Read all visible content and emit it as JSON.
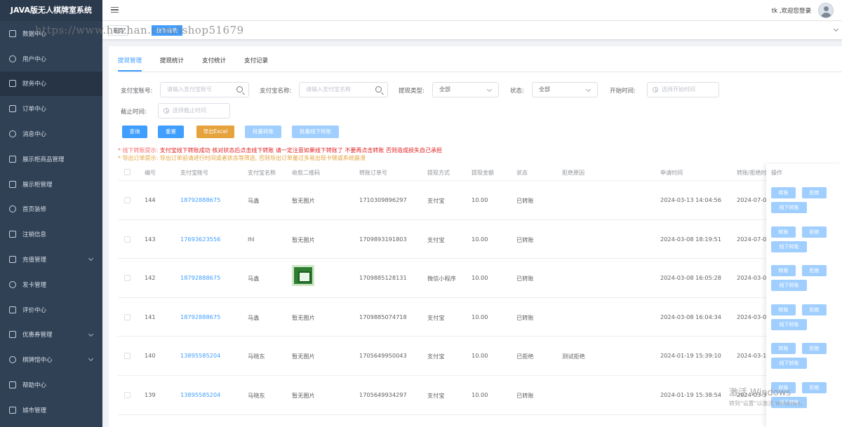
{
  "app": {
    "title": "JAVA版无人棋牌室系统"
  },
  "sidebar": {
    "items": [
      {
        "label": "数据中心",
        "icon": "dashboard-icon"
      },
      {
        "label": "用户中心",
        "icon": "user-icon"
      },
      {
        "label": "财务中心",
        "icon": "wallet-icon",
        "active": true
      },
      {
        "label": "订单中心",
        "icon": "order-icon"
      },
      {
        "label": "消息中心",
        "icon": "message-icon"
      },
      {
        "label": "展示柜商品管理",
        "icon": "box-icon"
      },
      {
        "label": "展示柜管理",
        "icon": "cabinet-icon"
      },
      {
        "label": "首页装修",
        "icon": "home-decor-icon"
      },
      {
        "label": "注销信息",
        "icon": "logout-icon"
      },
      {
        "label": "充值管理",
        "icon": "recharge-icon",
        "expandable": true
      },
      {
        "label": "发卡管理",
        "icon": "card-icon"
      },
      {
        "label": "评价中心",
        "icon": "comment-icon"
      },
      {
        "label": "优惠券管理",
        "icon": "coupon-icon",
        "expandable": true
      },
      {
        "label": "棋牌馆中心",
        "icon": "store-icon",
        "expandable": true
      },
      {
        "label": "帮助中心",
        "icon": "help-icon"
      },
      {
        "label": "城市管理",
        "icon": "city-icon"
      }
    ]
  },
  "topbar": {
    "welcome": "tk ,欢迎您登录"
  },
  "tagsbar": {
    "tags": [
      "首页",
      "提现管理"
    ],
    "watermark": "https://www.huzhan.com/ishop51679"
  },
  "tabs": [
    "提现管理",
    "提现统计",
    "支付统计",
    "支付记录"
  ],
  "filters": {
    "alipay_account_label": "支付宝账号:",
    "alipay_account_placeholder": "请输入支付宝账号",
    "alipay_name_label": "支付宝名称:",
    "alipay_name_placeholder": "请输入支付宝名称",
    "withdraw_type_label": "提现类型:",
    "withdraw_type_value": "全部",
    "status_label": "状态:",
    "status_value": "全部",
    "start_time_label": "开始时间:",
    "start_time_placeholder": "选择开始时间",
    "end_time_label": "截止时间:",
    "end_time_placeholder": "选择截止时间"
  },
  "actions": {
    "query": "查询",
    "reset": "重置",
    "export": "导出Excel",
    "batch_transfer": "批量转账",
    "batch_offline": "批量线下转账"
  },
  "tips": {
    "offline_title": "* 线下转账提示:",
    "offline_text": "支付宝线下转账成功 核对状态后点击线下转账 请一定注意如果线下转账了 不要再点击转账 否则造成损失自己承担",
    "export_text": "* 导出订单提示: 导出订单前请进行时间或者状态等筛选, 否则导出订单量过多易出现卡顿或系统崩溃"
  },
  "table": {
    "headers": [
      "编号",
      "支付宝账号",
      "支付宝名称",
      "收款二维码",
      "转账订单号",
      "提现方式",
      "提现金额",
      "状态",
      "拒绝原因",
      "申请时间",
      "转账/拒绝时",
      "操作"
    ],
    "rows": [
      {
        "id": "144",
        "account": "18792888675",
        "name": "马鑫",
        "qr": "暂无图片",
        "order": "1710309896297",
        "method": "支付宝",
        "amount": "10.00",
        "status": "已转账",
        "reason": "",
        "apply_time": "2024-03-13 14:04:56",
        "done_time": "2024-07-02"
      },
      {
        "id": "143",
        "account": "17693623556",
        "name": "lhl",
        "qr": "暂无图片",
        "order": "1709893191803",
        "method": "支付宝",
        "amount": "10.00",
        "status": "已转账",
        "reason": "",
        "apply_time": "2024-03-08 18:19:51",
        "done_time": "2024-07-0"
      },
      {
        "id": "142",
        "account": "18792888675",
        "name": "马鑫",
        "qr": "",
        "order": "1709885128131",
        "method": "微信小程序",
        "amount": "10.00",
        "status": "已转账",
        "reason": "",
        "apply_time": "2024-03-08 16:05:28",
        "done_time": "2024-03-0"
      },
      {
        "id": "141",
        "account": "18792888675",
        "name": "马鑫",
        "qr": "暂无图片",
        "order": "1709885074718",
        "method": "支付宝",
        "amount": "10.00",
        "status": "已转账",
        "reason": "",
        "apply_time": "2024-03-08 16:04:34",
        "done_time": "2024-03-0"
      },
      {
        "id": "140",
        "account": "13895585204",
        "name": "马晓东",
        "qr": "暂无图片",
        "order": "1705649950043",
        "method": "支付宝",
        "amount": "10.00",
        "status": "已拒绝",
        "reason": "测试拒绝",
        "apply_time": "2024-01-19 15:39:10",
        "done_time": "2024-03-1"
      },
      {
        "id": "139",
        "account": "13895585204",
        "name": "马晓东",
        "qr": "暂无图片",
        "order": "1705649934297",
        "method": "支付宝",
        "amount": "10.00",
        "status": "已转账",
        "reason": "",
        "apply_time": "2024-01-19 15:38:54",
        "done_time": "2024-03-3"
      }
    ],
    "op_labels": {
      "transfer": "转账",
      "reject": "拒绝",
      "offline": "线下转账"
    }
  },
  "windows_watermark": {
    "line1": "激活 Windows",
    "line2": "转到\"设置\"以激活 Windows。"
  },
  "colors": {
    "primary": "#409eff",
    "sidebar_bg": "#304156",
    "warning": "#e6a23c",
    "danger": "#f56c6c"
  }
}
